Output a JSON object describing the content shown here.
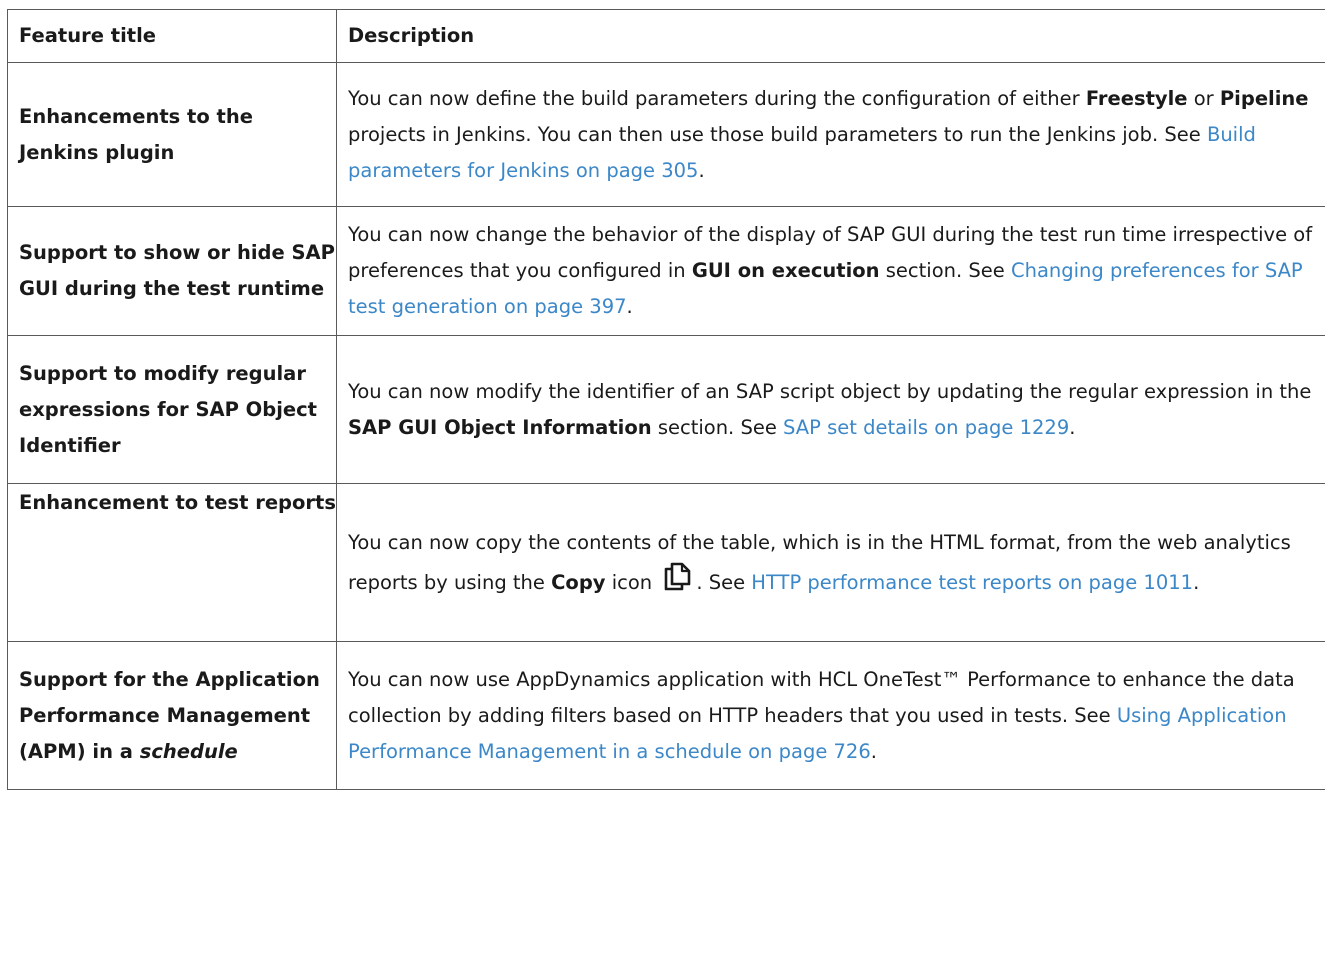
{
  "table": {
    "headers": {
      "title": "Feature title",
      "description": "Description"
    },
    "rows": [
      {
        "title": "Enhancements to the Jenkins plugin",
        "desc": {
          "t1": "You can now define the build parameters during the configuration of either ",
          "b1": "Freestyle",
          "t2": " or ",
          "b2": "Pipeline",
          "t3": " projects in Jenkins. You can then use those build parameters to run the Jenkins job. See ",
          "link": "Build parameters for Jenkins on page 305",
          "t4": "."
        }
      },
      {
        "title": "Support to show or hide SAP GUI during the test runtime",
        "desc": {
          "t1": "You can now change the behavior of the display of SAP GUI during the test run time irrespective of preferences that you configured in ",
          "b1": "GUI on execution",
          "t2": " section. See ",
          "link": "Changing preferences for SAP test generation on page 397",
          "t3": "."
        }
      },
      {
        "title": "Support to modify regular expressions for SAP Object Identifier",
        "desc": {
          "t1": "You can now modify the identifier of an SAP script object by updating the regular expression in the ",
          "b1": "SAP GUI Object Information",
          "t2": " section. See ",
          "link": "SAP set details on page 1229",
          "t3": "."
        }
      },
      {
        "title": "Enhancement to test reports",
        "desc": {
          "t1": "You can now copy the contents of the table, which is in the HTML format, from the web analytics reports by using the ",
          "b1": "Copy",
          "t2": " icon ",
          "icon": "copy-icon",
          "t3": ". See ",
          "link": "HTTP performance test reports on page 1011",
          "t4": "."
        }
      },
      {
        "title_plain": "Support for the Application Performance Management (APM) in a ",
        "title_italic": "schedule",
        "desc": {
          "t1": "You can now use AppDynamics application with HCL OneTest™ Performance to enhance the data collection by adding filters based on HTTP headers that you used in tests. See ",
          "link": "Using Application Performance Management in a schedule on page 726",
          "t2": "."
        }
      }
    ]
  },
  "colors": {
    "link": "#3b87c8",
    "border": "#5a5a5a",
    "text": "#1a1a1a"
  }
}
